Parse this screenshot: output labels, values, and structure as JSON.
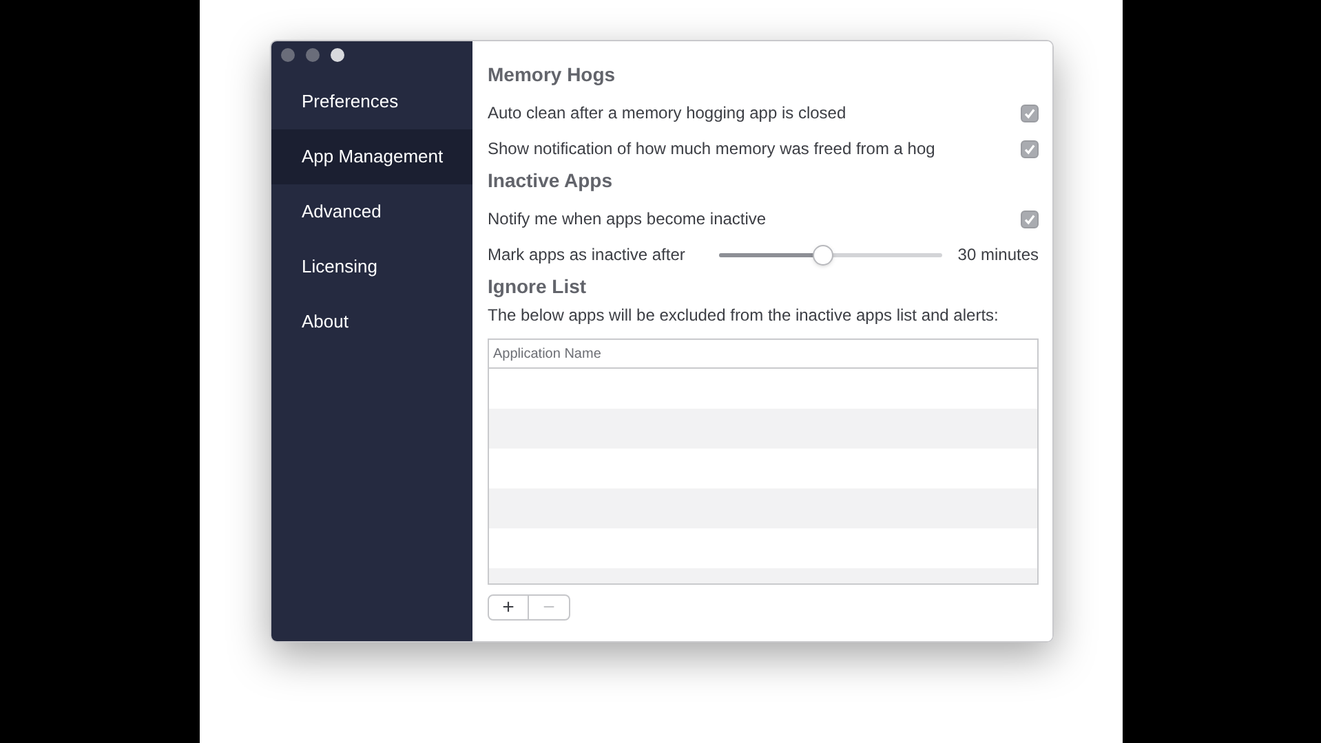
{
  "sidebar": {
    "items": [
      {
        "label": "Preferences",
        "selected": false
      },
      {
        "label": "App Management",
        "selected": true
      },
      {
        "label": "Advanced",
        "selected": false
      },
      {
        "label": "Licensing",
        "selected": false
      },
      {
        "label": "About",
        "selected": false
      }
    ]
  },
  "sections": [
    {
      "title": "Memory Hogs",
      "rows": [
        {
          "kind": "checkbox",
          "label": "Auto clean after a memory hogging app is closed",
          "checked": true
        },
        {
          "kind": "checkbox",
          "label": "Show notification of how much memory was freed from a hog",
          "checked": true
        }
      ]
    },
    {
      "title": "Inactive Apps",
      "rows": [
        {
          "kind": "checkbox",
          "label": "Notify me when apps become inactive",
          "checked": true
        },
        {
          "kind": "slider",
          "label": "Mark apps as inactive after",
          "level": 0.46,
          "reading": "30 minutes"
        }
      ]
    }
  ],
  "ignore_list": {
    "title": "Ignore List",
    "description": "The below apps will be excluded from the inactive apps list and alerts:",
    "table": {
      "columns": [
        "Application Name"
      ]
    },
    "buttons": [
      {
        "label": "+",
        "disabled": false
      },
      {
        "label": "−",
        "disabled": true
      }
    ]
  }
}
